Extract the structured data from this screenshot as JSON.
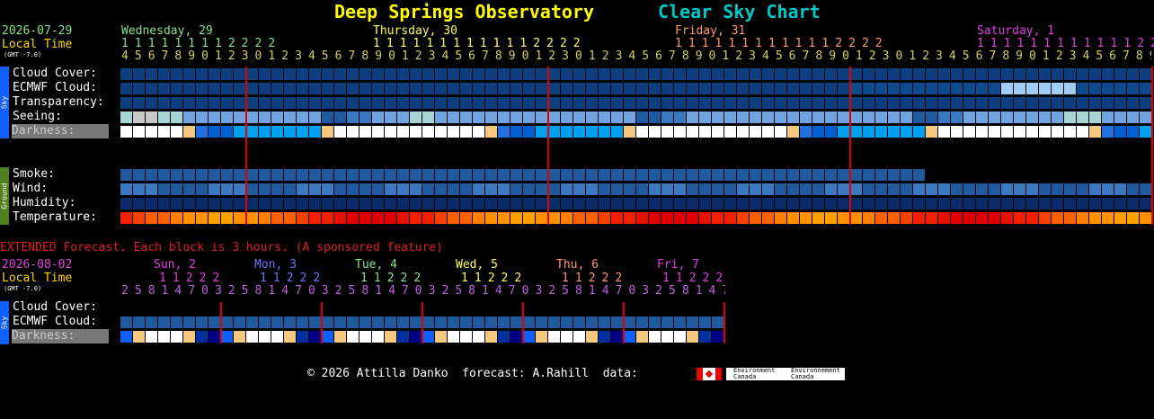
{
  "header": {
    "title_left": "Deep Springs Observatory",
    "title_right": "Clear Sky Chart",
    "colors": {
      "left": "#ffff00",
      "right": "#00c8c8"
    }
  },
  "main": {
    "date": "2026-07-29",
    "local_time": "Local Time",
    "gmt": "(GMT -7.0)",
    "days": [
      {
        "label": "Wednesday, 29",
        "color": "#8ae28a"
      },
      {
        "label": "Thursday, 30",
        "color": "#ffff60"
      },
      {
        "label": "Friday, 31",
        "color": "#ff9966"
      },
      {
        "label": "Saturday, 1",
        "color": "#e040e0"
      }
    ],
    "hours_top": "1 1 1 1 1 1 1 1 2 2 2 2",
    "hours_top2": "1 1 1 1 1 1 1 1 1 1 1 1 2 2 2 2",
    "hours_bottom": "4 5 6 7 8 9 0 1 2 3 0 1 2 3 4 5 6 7 8 9 0 1 2 3 4 5 6 7 8 9 0 1 2 3 0 1 2 3 4 5 6 7 8 9 0 1 2 3 4 5 6 7 8 9 0 1 2 3 0 1 2 3 4 5 6 7 8 9 0 1 2 3 4 5 6 7 8 9 0 1 2 3 0 1 2 3 4 5 6 7 8 9 0 1 2 3 4 5 6 7 8 9 0 1 2 3",
    "sky_band": "Sky",
    "ground_band": "Ground",
    "rows": {
      "cloud": "Cloud Cover:",
      "ecmwf": "ECMWF Cloud:",
      "transparency": "Transparency:",
      "seeing": "Seeing:",
      "darkness": "Darkness:",
      "smoke": "Smoke:",
      "wind": "Wind:",
      "humidity": "Humidity:",
      "temperature": "Temperature:"
    }
  },
  "extended": {
    "notice": "EXTENDED Forecast. Each block is 3 hours. (A sponsored feature)",
    "date": "2026-08-02",
    "local_time": "Local Time",
    "gmt": "(GMT -7.0)",
    "days": [
      {
        "label": "Sun, 2",
        "color": "#e040e0"
      },
      {
        "label": "Mon, 3",
        "color": "#7070ff"
      },
      {
        "label": "Tue, 4",
        "color": "#8ae28a"
      },
      {
        "label": "Wed, 5",
        "color": "#ffff60"
      },
      {
        "label": "Thu, 6",
        "color": "#ff9966"
      },
      {
        "label": "Fri, 7",
        "color": "#e040e0"
      }
    ],
    "hours_top": "1 1 2 2 2",
    "hours_bottom": "2 5 8 1 4 7 0 3 2 5 8 1 4 7 0 3 2 5 8 1 4 7 0 3 2 5 8 1 4 7 0 3 2 5 8 1 4 7 0 3 2 5 8 1 4 7 0 3",
    "rows": {
      "cloud": "Cloud Cover:",
      "ecmwf": "ECMWF Cloud:",
      "darkness": "Darkness:"
    }
  },
  "footer": {
    "text": "© 2026 Attilla Danko  forecast: A.Rahill  data:",
    "env1": "Environment Canada",
    "env2": "Environnement Canada"
  }
}
